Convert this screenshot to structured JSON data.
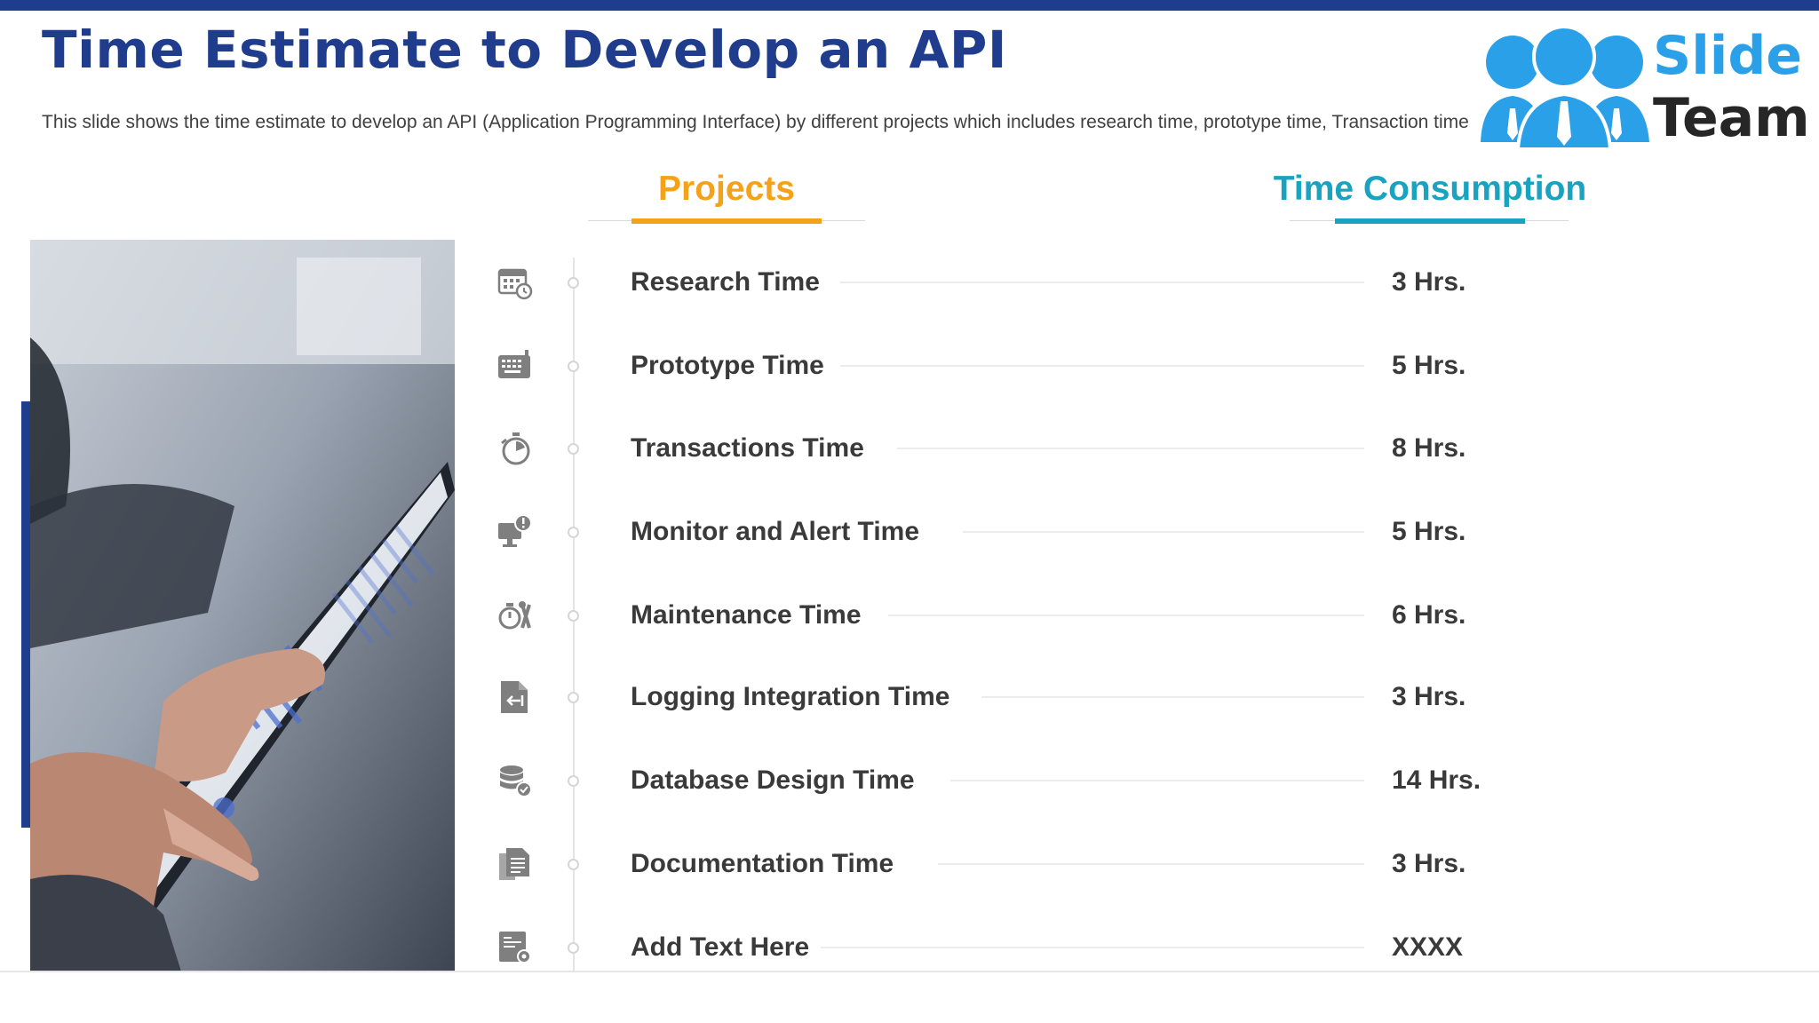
{
  "slide": {
    "title": "Time Estimate to Develop an API",
    "subtitle": "This slide shows the time estimate to develop an API (Application Programming Interface) by different projects which includes research time, prototype time, Transaction time"
  },
  "logo": {
    "word1": "Slide",
    "word2": "Team"
  },
  "columns": {
    "projects": "Projects",
    "time": "Time Consumption"
  },
  "colors": {
    "title_blue": "#1f3d8c",
    "projects_orange": "#f5a21b",
    "time_teal": "#19a3c0",
    "logo_blue": "#2aa0e8"
  },
  "rows": [
    {
      "label": "Research Time",
      "value": "3 Hrs.",
      "icon": "calendar-clock-icon"
    },
    {
      "label": "Prototype Time",
      "value": "5 Hrs.",
      "icon": "keyboard-icon"
    },
    {
      "label": "Transactions Time",
      "value": "8 Hrs.",
      "icon": "stopwatch-icon"
    },
    {
      "label": "Monitor and Alert Time",
      "value": "5 Hrs.",
      "icon": "monitor-alert-icon"
    },
    {
      "label": "Maintenance Time",
      "value": "6 Hrs.",
      "icon": "timer-tools-icon"
    },
    {
      "label": "Logging Integration Time",
      "value": "3 Hrs.",
      "icon": "login-document-icon"
    },
    {
      "label": "Database Design Time",
      "value": "14 Hrs.",
      "icon": "database-check-icon"
    },
    {
      "label": "Documentation Time",
      "value": "3 Hrs.",
      "icon": "documents-icon"
    },
    {
      "label": "Add Text Here",
      "value": "XXXX",
      "icon": "settings-document-icon"
    }
  ]
}
